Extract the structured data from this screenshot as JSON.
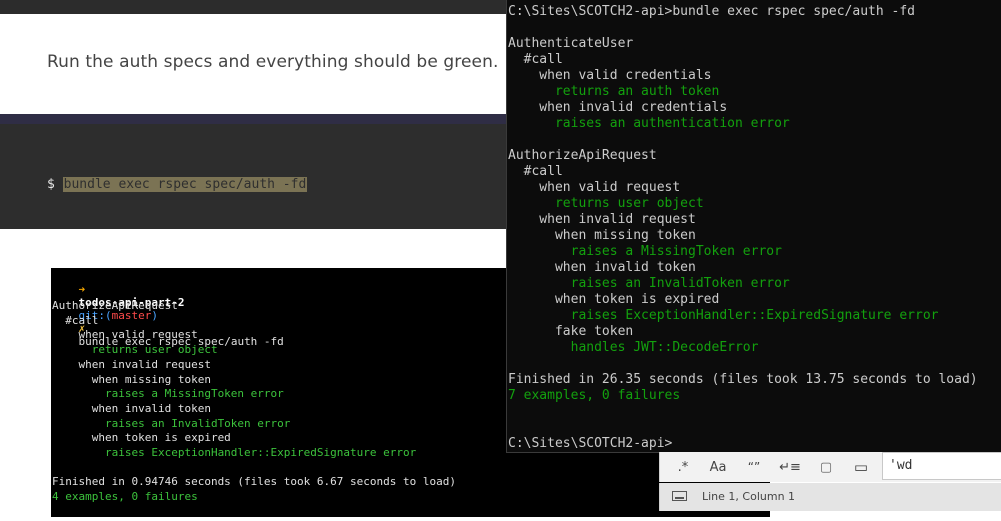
{
  "article": {
    "paragraph": "Run the auth specs and everything should be green.",
    "code_prompt": "$",
    "code_command": "bundle exec rspec spec/auth -fd"
  },
  "screenshot_terminal": {
    "prompt_dir": "todos-api-part-2",
    "prompt_git": "git:(",
    "prompt_branch": "master",
    "prompt_git_close": ")",
    "prompt_x": "✗",
    "prompt_cmd": "bundle exec rspec spec/auth -fd",
    "lines": [
      {
        "text": "AuthorizeApiRequest",
        "color": "default"
      },
      {
        "text": "  #call",
        "color": "default"
      },
      {
        "text": "    when valid request",
        "color": "default"
      },
      {
        "text": "      returns user object",
        "color": "green"
      },
      {
        "text": "    when invalid request",
        "color": "default"
      },
      {
        "text": "      when missing token",
        "color": "default"
      },
      {
        "text": "        raises a MissingToken error",
        "color": "green"
      },
      {
        "text": "      when invalid token",
        "color": "default"
      },
      {
        "text": "        raises an InvalidToken error",
        "color": "green"
      },
      {
        "text": "      when token is expired",
        "color": "default"
      },
      {
        "text": "        raises ExceptionHandler::ExpiredSignature error",
        "color": "green"
      },
      {
        "text": "",
        "color": "default"
      },
      {
        "text": "Finished in 0.94746 seconds (files took 6.67 seconds to load)",
        "color": "default"
      },
      {
        "text": "4 examples, 0 failures",
        "color": "green"
      }
    ]
  },
  "main_terminal": {
    "lines": [
      {
        "text": "C:\\Sites\\SCOTCH2-api>bundle exec rspec spec/auth -fd",
        "color": "default"
      },
      {
        "text": "",
        "color": "default"
      },
      {
        "text": "AuthenticateUser",
        "color": "default"
      },
      {
        "text": "  #call",
        "color": "default"
      },
      {
        "text": "    when valid credentials",
        "color": "default"
      },
      {
        "text": "      returns an auth token",
        "color": "green"
      },
      {
        "text": "    when invalid credentials",
        "color": "default"
      },
      {
        "text": "      raises an authentication error",
        "color": "green"
      },
      {
        "text": "",
        "color": "default"
      },
      {
        "text": "AuthorizeApiRequest",
        "color": "default"
      },
      {
        "text": "  #call",
        "color": "default"
      },
      {
        "text": "    when valid request",
        "color": "default"
      },
      {
        "text": "      returns user object",
        "color": "green"
      },
      {
        "text": "    when invalid request",
        "color": "default"
      },
      {
        "text": "      when missing token",
        "color": "default"
      },
      {
        "text": "        raises a MissingToken error",
        "color": "green"
      },
      {
        "text": "      when invalid token",
        "color": "default"
      },
      {
        "text": "        raises an InvalidToken error",
        "color": "green"
      },
      {
        "text": "      when token is expired",
        "color": "default"
      },
      {
        "text": "        raises ExceptionHandler::ExpiredSignature error",
        "color": "green"
      },
      {
        "text": "      fake token",
        "color": "default"
      },
      {
        "text": "        handles JWT::DecodeError",
        "color": "green"
      },
      {
        "text": "",
        "color": "default"
      },
      {
        "text": "Finished in 26.35 seconds (files took 13.75 seconds to load)",
        "color": "default"
      },
      {
        "text": "7 examples, 0 failures",
        "color": "green"
      },
      {
        "text": "",
        "color": "default"
      },
      {
        "text": "",
        "color": "default"
      },
      {
        "text": "C:\\Sites\\SCOTCH2-api>",
        "color": "default"
      }
    ]
  },
  "find_widget": {
    "regex_label": ".*",
    "case_label": "Aa",
    "word_label": "“”",
    "wrap_label": "↵≡",
    "selection_label": "▢",
    "highlight_label": "▭",
    "input_value": "'wd"
  },
  "status_bar": {
    "position": "Line 1, Column 1"
  },
  "colors": {
    "terminal_green": "#13a10e",
    "terminal_bg": "#0c0c0c",
    "code_highlight": "#7b7354"
  }
}
